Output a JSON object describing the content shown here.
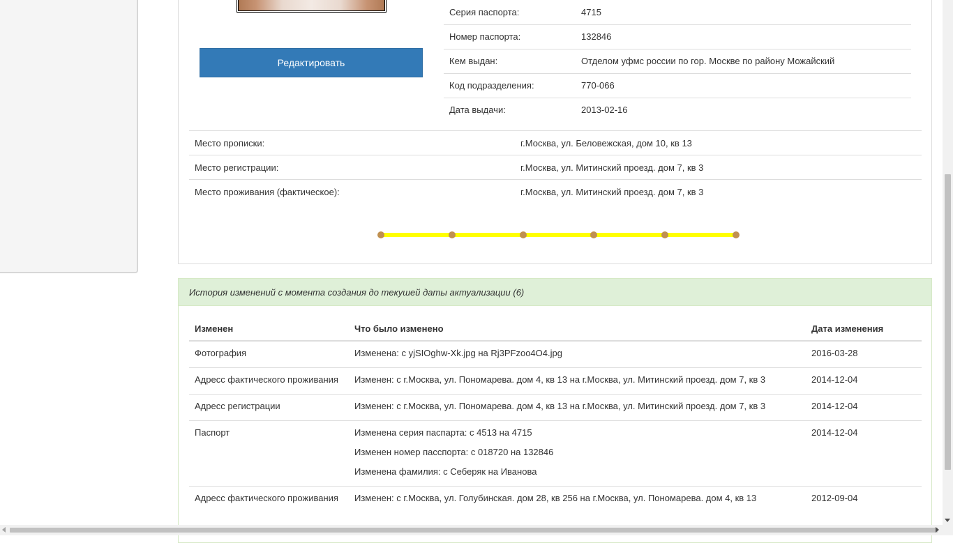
{
  "profile": {
    "edit_label": "Редактировать",
    "passport": [
      {
        "label": "Серия паспорта:",
        "value": "4715"
      },
      {
        "label": "Номер паспорта:",
        "value": "132846"
      },
      {
        "label": "Кем выдан:",
        "value": "Отделом уфмс россии по гор. Москве по району Можайский"
      },
      {
        "label": "Код подразделения:",
        "value": "770-066"
      },
      {
        "label": "Дата выдачи:",
        "value": "2013-02-16"
      }
    ],
    "addresses": [
      {
        "label": "Место прописки:",
        "value": "г.Москва, ул. Беловежская, дом 10, кв 13"
      },
      {
        "label": "Место регистрации:",
        "value": "г.Москва, ул. Митинский проезд. дом 7, кв 3"
      },
      {
        "label": "Место проживания (фактическое):",
        "value": "г.Москва, ул. Митинский проезд. дом 7, кв 3"
      }
    ],
    "timeline": {
      "points": 6,
      "bar_color": "#ffff00",
      "dot_color": "#c09050"
    }
  },
  "history": {
    "heading": "История изменений с момента создания до текушей даты актуализации (6)",
    "columns": [
      "Изменен",
      "Что было изменено",
      "Дата изменения"
    ],
    "rows": [
      {
        "field": "Фотография",
        "changes": [
          "Изменена: с yjSIOghw-Xk.jpg на Rj3PFzoo4O4.jpg"
        ],
        "date": "2016-03-28"
      },
      {
        "field": "Адресс фактического проживания",
        "changes": [
          "Изменен: с г.Москва, ул. Пономарева. дом 4, кв 13 на г.Москва, ул. Митинский проезд. дом 7, кв 3"
        ],
        "date": "2014-12-04"
      },
      {
        "field": "Адресс регистрации",
        "changes": [
          "Изменен: с г.Москва, ул. Пономарева. дом 4, кв 13 на г.Москва, ул. Митинский проезд. дом 7, кв 3"
        ],
        "date": "2014-12-04"
      },
      {
        "field": "Паспорт",
        "changes": [
          "Изменена серия паспарта: с 4513 на 4715",
          "Изменен номер пасспорта: с 018720 на 132846",
          "Изменена фамилия: с Себеряк на Иванова"
        ],
        "date": "2014-12-04"
      },
      {
        "field": "Адресс фактического проживания",
        "changes": [
          "Изменен: с г.Москва, ул. Голубинская. дом 28, кв 256 на г.Москва, ул. Пономарева. дом 4, кв 13"
        ],
        "date": "2012-09-04"
      }
    ]
  },
  "colors": {
    "primary": "#337ab7",
    "success_bg": "#dff0d8",
    "success_border": "#d6e9c6"
  }
}
